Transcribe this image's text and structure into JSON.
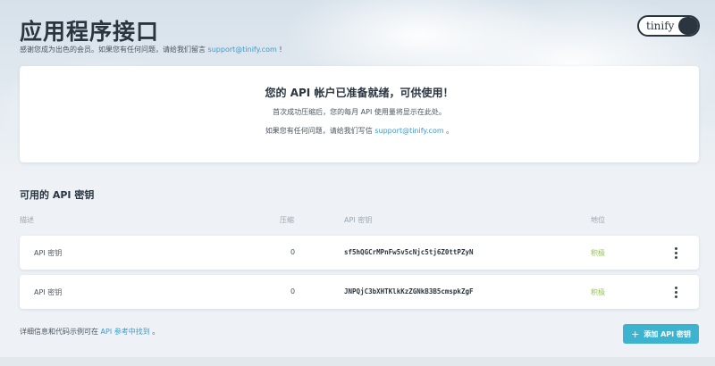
{
  "header": {
    "title": "应用程序接口",
    "subtitle_prefix": "感谢您成为出色的会员。如果您有任何问题，请给我们留言",
    "subtitle_email": "support@tinify.com",
    "subtitle_suffix": "!",
    "logo_text": "tinify"
  },
  "ready_card": {
    "title": "您的 API 帐户已准备就绪，可供使用！",
    "line1": "首次成功压缩后，您的每月 API 使用量将显示在此处。",
    "line2_prefix": "如果您有任何问题，请给我们写信",
    "line2_email": "support@tinify.com",
    "line2_suffix": "。"
  },
  "keys": {
    "section_title": "可用的 API 密钥",
    "columns": {
      "description": "描述",
      "compressions": "压缩",
      "api_key": "API 密钥",
      "status": "地位"
    },
    "rows": [
      {
        "description": "API 密钥",
        "compressions": "0",
        "key": "sf5hQGCrMPnFw5v5cNjc5tj6Z0ttPZyN",
        "status": "积极"
      },
      {
        "description": "API 密钥",
        "compressions": "0",
        "key": "JNPQjC3bXHTKlkKzZGNkB3B5cmspkZgF",
        "status": "积极"
      }
    ]
  },
  "footer": {
    "note_prefix": "详细信息和代码示例可在",
    "note_link": "API 参考中找到",
    "note_suffix": "。",
    "add_button_label": "添加 API 密钥"
  },
  "colors": {
    "accent": "#3cb4cf",
    "link": "#3a9bd0",
    "status_active": "#8cc63f",
    "text_dark": "#2a3540"
  },
  "icons": {
    "plus": "plus-icon",
    "row_menu": "kebab-menu-icon"
  }
}
